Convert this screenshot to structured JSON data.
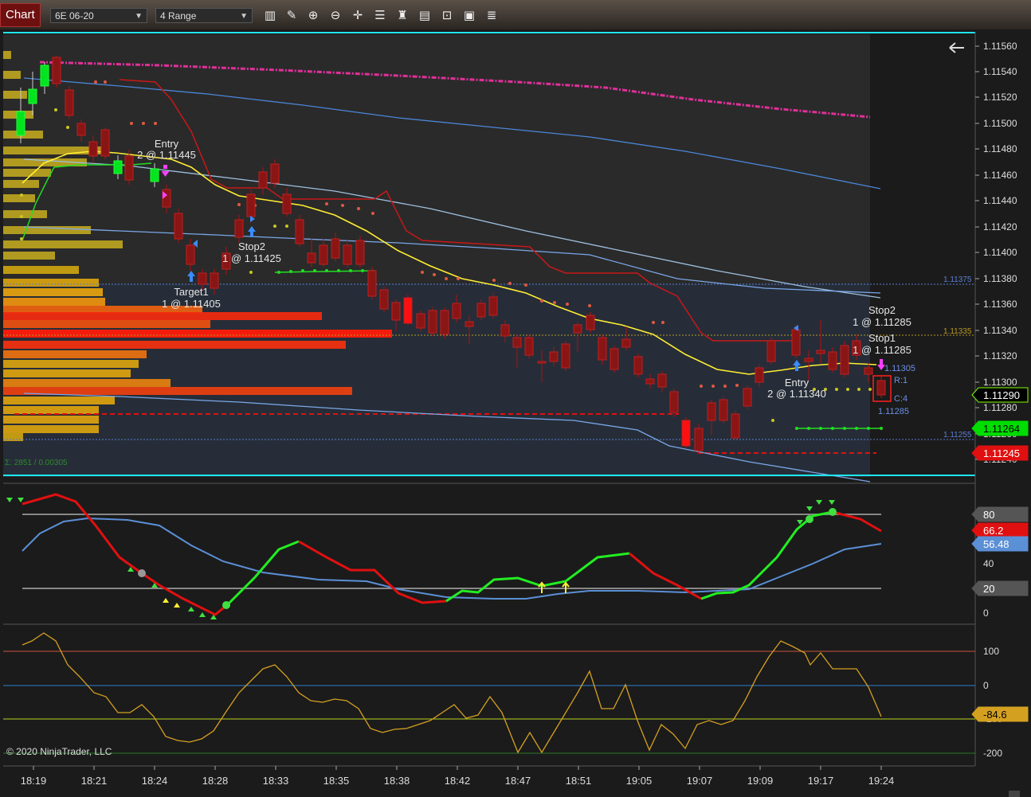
{
  "toolbar": {
    "tab_label": "Chart",
    "instrument": "6E 06-20",
    "interval": "4 Range",
    "tools": [
      "bar-chart-icon",
      "pencil-icon",
      "zoom-in-icon",
      "zoom-out-icon",
      "crosshair-icon",
      "properties-icon",
      "strategies-icon",
      "indicators-icon",
      "data-box-icon",
      "list-icon"
    ]
  },
  "price_panel": {
    "axis_ticks": [
      "1.11560",
      "1.11540",
      "1.11520",
      "1.11500",
      "1.11480",
      "1.11460",
      "1.11440",
      "1.11420",
      "1.11400",
      "1.11380",
      "1.11360",
      "1.11340",
      "1.11320",
      "1.11300",
      "1.11280",
      "1.11260",
      "1.11240"
    ],
    "level_labels": [
      "1.11375",
      "1.11335",
      "1.11255"
    ],
    "price_badges": [
      {
        "text": "1.11290",
        "color": "#000000",
        "fg": "#ffffff",
        "border": "#7fff00"
      },
      {
        "text": "1.11264",
        "color": "#00dd00",
        "fg": "#000000",
        "border": "#00dd00"
      },
      {
        "text": "1.11245",
        "color": "#e01010",
        "fg": "#ffffff",
        "border": "#e01010"
      }
    ],
    "annotations": [
      {
        "line1": "Entry",
        "line2": "2 @ 1.11445"
      },
      {
        "line1": "Stop2",
        "line2": "1 @ 1.11425"
      },
      {
        "line1": "Target1",
        "line2": "1 @ 1.11405"
      },
      {
        "line1": "Stop2",
        "line2": "1 @ 1.11285"
      },
      {
        "line1": "Stop1",
        "line2": "1 @ 1.11285"
      },
      {
        "line1": "Entry",
        "line2": "2 @ 1.11340"
      }
    ],
    "order_labels": [
      "1.11305",
      "R:1",
      "C:4",
      "1.11285"
    ],
    "volume_stat": "Σ: 2851 / 0.00305"
  },
  "stochastic_panel": {
    "axis_ticks": [
      "80",
      "60",
      "40",
      "20",
      "0"
    ],
    "badges": [
      {
        "text": "80",
        "color": "#555555"
      },
      {
        "text": "66.2",
        "color": "#e01010"
      },
      {
        "text": "56.48",
        "color": "#5b8fd6"
      },
      {
        "text": "20",
        "color": "#555555"
      }
    ]
  },
  "cci_panel": {
    "axis_ticks": [
      "100",
      "0",
      "-100",
      "-200"
    ],
    "badge": {
      "text": "-84.6",
      "color": "#d4a020"
    }
  },
  "time_labels": [
    "18:19",
    "18:21",
    "18:24",
    "18:28",
    "18:33",
    "18:35",
    "18:38",
    "18:42",
    "18:47",
    "18:51",
    "19:05",
    "19:07",
    "19:09",
    "19:17",
    "19:24"
  ],
  "copyright": "© 2020 NinjaTrader, LLC",
  "colors": {
    "bull": "#00e51e",
    "bear": "#b01010",
    "ema": "#ffee33",
    "cci": "#d4a020",
    "stoch_k": "#e01010",
    "stoch_d": "#5b8fd6"
  }
}
